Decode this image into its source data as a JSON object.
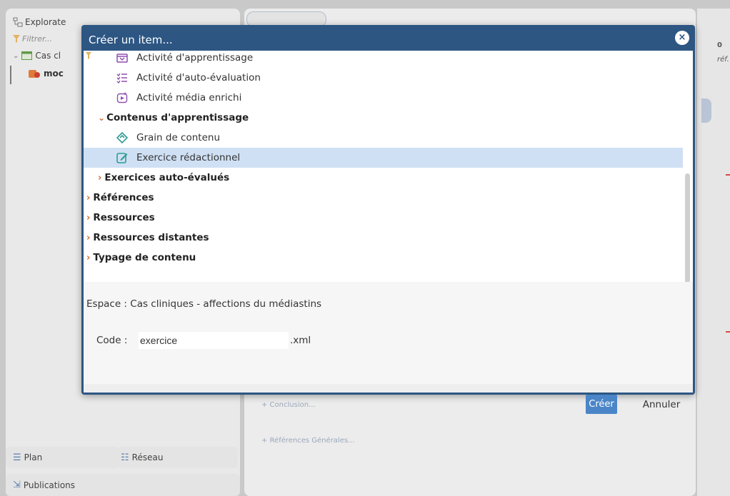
{
  "background": {
    "explorer_label": "Explorate",
    "filter_placeholder": "Filtrer...",
    "cas_label": "Cas cl",
    "mod_label": "moc",
    "tab_plan": "Plan",
    "tab_reseau": "Réseau",
    "tab_publications": "Publications",
    "link_conclusion": "+ Conclusion...",
    "link_references": "+ Références Générales...",
    "right_count": "0",
    "right_ref": "réf."
  },
  "dialog": {
    "title": "Créer un item...",
    "close_label": "×",
    "items": [
      {
        "label": "Activité d'apprentissage",
        "kind": "item",
        "icon": "learning-activity-icon"
      },
      {
        "label": "Activité d'auto-évaluation",
        "kind": "item",
        "icon": "self-evaluation-icon"
      },
      {
        "label": "Activité média enrichi",
        "kind": "item",
        "icon": "enriched-media-icon"
      },
      {
        "label": "Contenus d'apprentissage",
        "kind": "category-open"
      },
      {
        "label": "Grain de contenu",
        "kind": "item",
        "icon": "content-grain-icon"
      },
      {
        "label": "Exercice rédactionnel",
        "kind": "item-selected",
        "icon": "writing-exercise-icon"
      },
      {
        "label": "Exercices auto-évalués",
        "kind": "category-closed"
      },
      {
        "label": "Références",
        "kind": "category-closed"
      },
      {
        "label": "Ressources",
        "kind": "category-closed"
      },
      {
        "label": "Ressources distantes",
        "kind": "category-closed"
      },
      {
        "label": "Typage de contenu",
        "kind": "category-closed"
      }
    ],
    "espace_text": "Espace : Cas cliniques - affections du médiastins",
    "code_label": "Code :",
    "code_value": "exercice",
    "code_ext": ".xml",
    "create_label": "Créer",
    "cancel_label": "Annuler"
  },
  "colors": {
    "dialog_header": "#2d5683",
    "selection": "#cfe0f4",
    "create_button": "#4a85c7",
    "chevron": "#d06a2c"
  }
}
